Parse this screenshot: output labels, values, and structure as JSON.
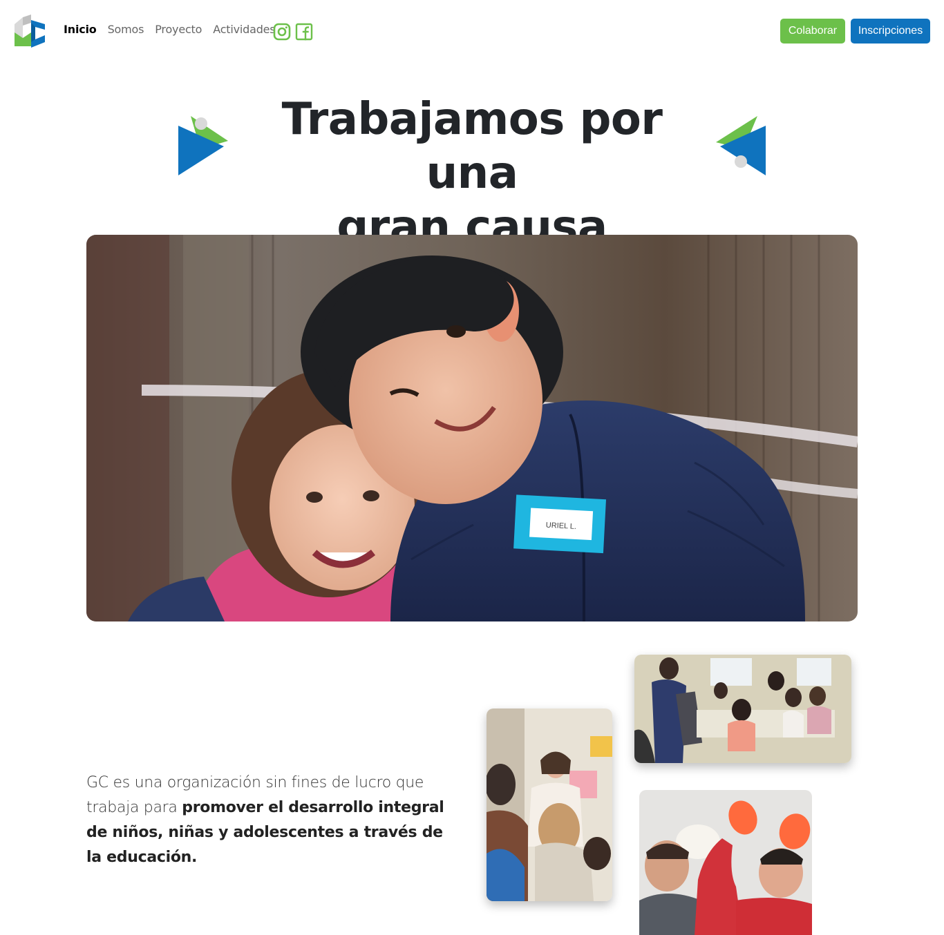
{
  "nav": {
    "links": [
      "Inicio",
      "Somos",
      "Proyecto",
      "Actividades"
    ],
    "active": "Inicio",
    "social": [
      "instagram-icon",
      "facebook-icon"
    ],
    "buttons": {
      "collaborate": "Colaborar",
      "register": "Inscripciones"
    }
  },
  "hero": {
    "title_line1": "Trabajamos por una",
    "title_line2": "gran causa"
  },
  "photo_tags": {
    "name_tag": "URIEL L."
  },
  "intro": {
    "plain": "GC es una organización sin fines de lucro que trabaja para ",
    "bold": "promover el desarrollo integral de niños, niñas y adolescentes a través de la educación."
  },
  "colors": {
    "brand_green": "#6cc04a",
    "brand_blue": "#0f73be",
    "text_dark": "#222529"
  }
}
